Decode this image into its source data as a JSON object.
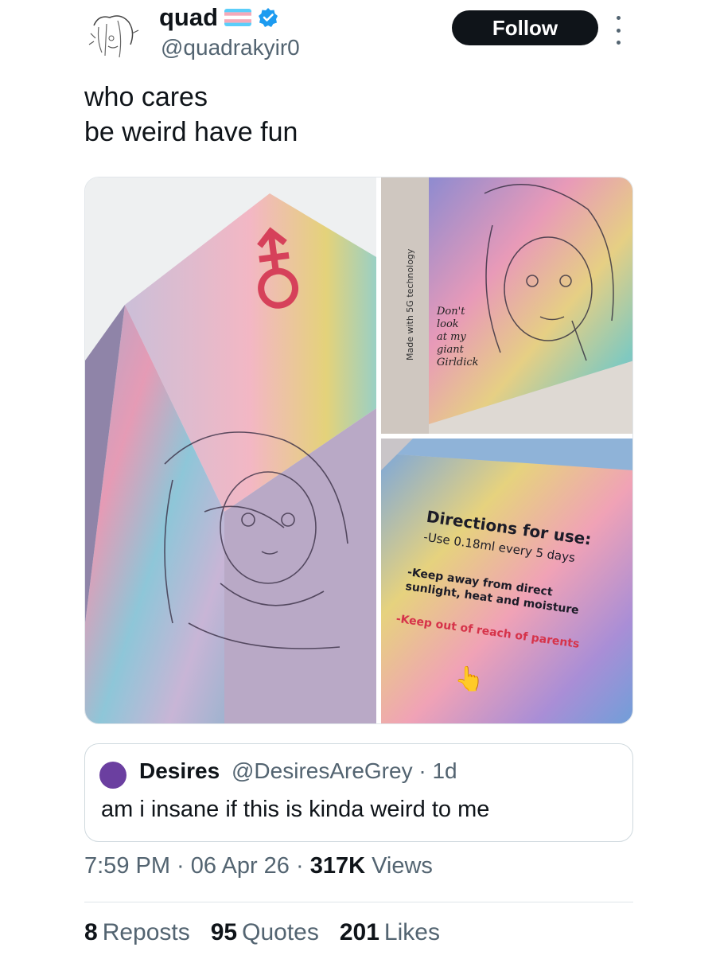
{
  "author": {
    "display_name": "quad",
    "handle": "@quadrakyir0",
    "flag_icon": "transgender-flag-icon",
    "verified_icon": "verified-badge-icon"
  },
  "actions": {
    "follow_label": "Follow",
    "more_icon": "more-vertical-icon"
  },
  "tweet": {
    "lines": [
      "who cares",
      "be weird have fun"
    ]
  },
  "media": {
    "left_panel": {
      "symbol": "⚦"
    },
    "top_right_panel": {
      "side_text": "Made with 5G technology",
      "caption_lines": [
        "Don't",
        "look",
        "at my",
        "giant",
        "Girldick"
      ]
    },
    "bottom_right_panel": {
      "heading": "Directions for use:",
      "line1": "-Use 0.18ml every 5 days",
      "line2": "-Keep away from direct",
      "line3": "sunlight, heat and moisture",
      "line4": "-Keep out of reach of parents",
      "pointer": "👆"
    }
  },
  "quote": {
    "name": "Desires",
    "handle_time": "@DesiresAreGrey · 1d",
    "text": "am i insane if this is kinda weird to me"
  },
  "meta": {
    "time": "7:59 PM · 06 Apr 26 · ",
    "views_count": "317K",
    "views_label": " Views"
  },
  "stats": {
    "reposts_count": "8",
    "reposts_label": "Reposts",
    "quotes_count": "95",
    "quotes_label": "Quotes",
    "likes_count": "201",
    "likes_label": "Likes"
  },
  "colors": {
    "follow_bg": "#0f1419",
    "verified": "#1d9bf0",
    "secondary_text": "#536471"
  }
}
